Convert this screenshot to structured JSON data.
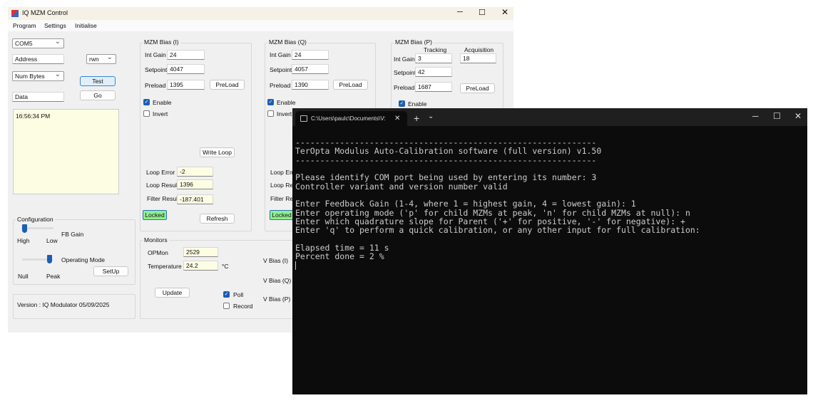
{
  "app": {
    "title": "IQ MZM Control",
    "menu": [
      "Program",
      "Settings",
      "Initialise"
    ]
  },
  "left": {
    "com_port": "COM5",
    "address_placeholder": "Address",
    "mode": "rwn",
    "num_bytes_placeholder": "Num Bytes",
    "data_placeholder": "Data",
    "test_label": "Test",
    "go_label": "Go",
    "log": "16:56:34 PM"
  },
  "config": {
    "title": "Configuration",
    "fb_gain_label": "FB Gain",
    "fb_high": "High",
    "fb_low": "Low",
    "fb_gain_value": "High",
    "op_mode_label": "Operating Mode",
    "op_null": "Null",
    "op_peak": "Peak",
    "op_mode_value": "Peak",
    "setup_label": "SetUp"
  },
  "version": "Version : IQ Modulator 05/09/2025",
  "bias_i": {
    "title": "MZM Bias (I)",
    "int_gain_label": "Int Gain",
    "int_gain": "24",
    "setpoint_label": "Setpoint",
    "setpoint": "4047",
    "preload_label": "Preload",
    "preload": "1395",
    "preload_btn": "PreLoad",
    "enable": "Enable",
    "invert": "Invert",
    "write_loop": "Write Loop",
    "loop_error_label": "Loop Error",
    "loop_error": "-2",
    "loop_result_label": "Loop Result",
    "loop_result": "1396",
    "filter_result_label": "Filter Result",
    "filter_result": "-187.401",
    "status": "Locked",
    "refresh": "Refresh"
  },
  "bias_q": {
    "title": "MZM Bias (Q)",
    "int_gain_label": "Int Gain",
    "int_gain": "24",
    "setpoint_label": "Setpoint",
    "setpoint": "4057",
    "preload_label": "Preload",
    "preload": "1390",
    "preload_btn": "PreLoad",
    "enable": "Enable",
    "invert": "Invert",
    "loop_error_label": "Loop Erro",
    "loop_result_label": "Loop Res",
    "filter_result_label": "Filter Res",
    "status": "Locked"
  },
  "bias_p": {
    "title": "MZM Bias (P)",
    "tracking": "Tracking",
    "acquisition": "Acquisition",
    "int_gain_label": "Int Gain",
    "int_gain_tracking": "3",
    "int_gain_acquisition": "18",
    "setpoint_label": "Setpoint",
    "setpoint": "42",
    "preload_label": "Preload",
    "preload": "1687",
    "preload_btn": "PreLoad",
    "enable": "Enable"
  },
  "monitors": {
    "title": "Monitors",
    "opmon_label": "OPMon",
    "opmon": "2529",
    "temp_label": "Temperature",
    "temp": "24.2",
    "temp_unit": "°C",
    "update": "Update",
    "poll": "Poll",
    "record": "Record",
    "vbias_i": "V Bias (I)",
    "vbias_q": "V Bias (Q)",
    "vbias_p": "V Bias (P)"
  },
  "terminal": {
    "tab_title": "C:\\Users\\paulc\\Documents\\V:",
    "lines": [
      "-------------------------------------------------------------",
      "TerOpta Modulus Auto-Calibration software (full version) v1.50",
      "-------------------------------------------------------------",
      "",
      "Please identify COM port being used by entering its number: 3",
      "Controller variant and version number valid",
      "",
      "Enter Feedback Gain (1-4, where 1 = highest gain, 4 = lowest gain): 1",
      "Enter operating mode ('p' for child MZMs at peak, 'n' for child MZMs at null): n",
      "Enter which quadrature slope for Parent ('+' for positive, '-' for negative): +",
      "Enter 'q' to perform a quick calibration, or any other input for full calibration:",
      "",
      "Elapsed time = 11 s",
      "Percent done = 2 %"
    ]
  }
}
